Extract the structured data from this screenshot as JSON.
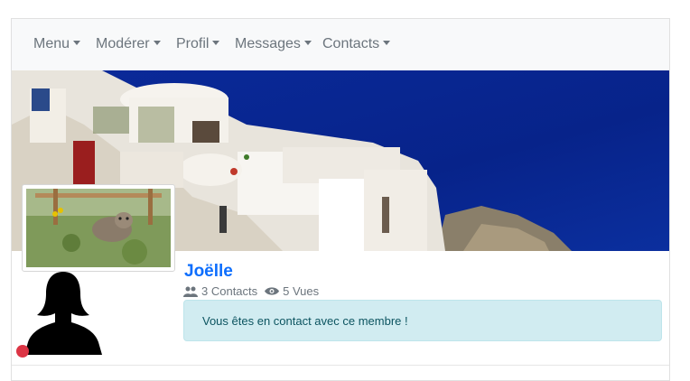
{
  "navbar": {
    "items": [
      {
        "label": "Menu"
      },
      {
        "label": "Modérer"
      },
      {
        "label": "Profil"
      },
      {
        "label": "Messages"
      },
      {
        "label": "Contacts"
      }
    ]
  },
  "profile": {
    "name": "Joëlle",
    "contacts_count": "3 Contacts",
    "views_count": "5 Vues",
    "contact_message": "Vous êtes en contact avec ce membre !",
    "status_color": "#dc3545"
  },
  "colors": {
    "accent": "#0d6efd",
    "alert_bg": "#d1ecf1",
    "alert_text": "#0c5460",
    "navbar_bg": "#f8f9fa"
  },
  "icons": {
    "contacts": "users-icon",
    "views": "eye-icon"
  }
}
